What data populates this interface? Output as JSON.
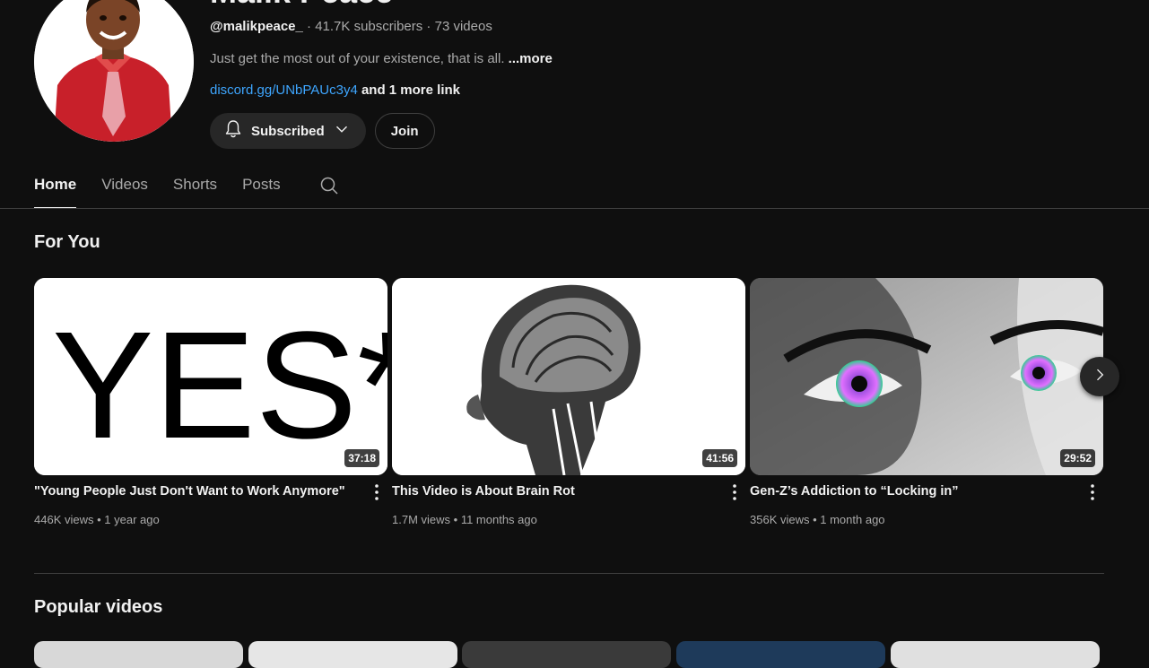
{
  "channel": {
    "name": "Malik Peace",
    "handle": "@malikpeace_",
    "subscribers": "41.7K subscribers",
    "videos_count": "73 videos",
    "separator": " · ",
    "description": "Just get the most out of your existence, that is all. ",
    "more_label": "...more",
    "link": "discord.gg/UNbPAUc3y4",
    "link_extra": " and 1 more link"
  },
  "buttons": {
    "subscribed": "Subscribed",
    "join": "Join"
  },
  "tabs": [
    {
      "label": "Home",
      "active": true
    },
    {
      "label": "Videos",
      "active": false
    },
    {
      "label": "Shorts",
      "active": false
    },
    {
      "label": "Posts",
      "active": false
    }
  ],
  "sections": {
    "for_you": "For You",
    "popular": "Popular videos"
  },
  "videos": [
    {
      "title": "\"Young People Just Don't Want to Work Anymore\"",
      "views": "446K views",
      "age": "1 year ago",
      "duration": "37:18",
      "thumb_text": "YES*"
    },
    {
      "title": "This Video is About Brain Rot",
      "views": "1.7M views",
      "age": "11 months ago",
      "duration": "41:56"
    },
    {
      "title": "Gen-Z’s Addiction to “Locking in”",
      "views": "356K views",
      "age": "1 month ago",
      "duration": "29:52"
    }
  ],
  "meta_separator": " • ",
  "colors": {
    "background": "#0f0f0f",
    "text": "#f1f1f1",
    "secondary_text": "#aaaaaa",
    "link": "#3ea6ff",
    "button_bg": "#272727"
  },
  "icons": {
    "bell": "bell-icon",
    "chevron": "chevron-down-icon",
    "search": "search-icon",
    "next": "chevron-right-icon",
    "kebab": "more-vert-icon"
  }
}
